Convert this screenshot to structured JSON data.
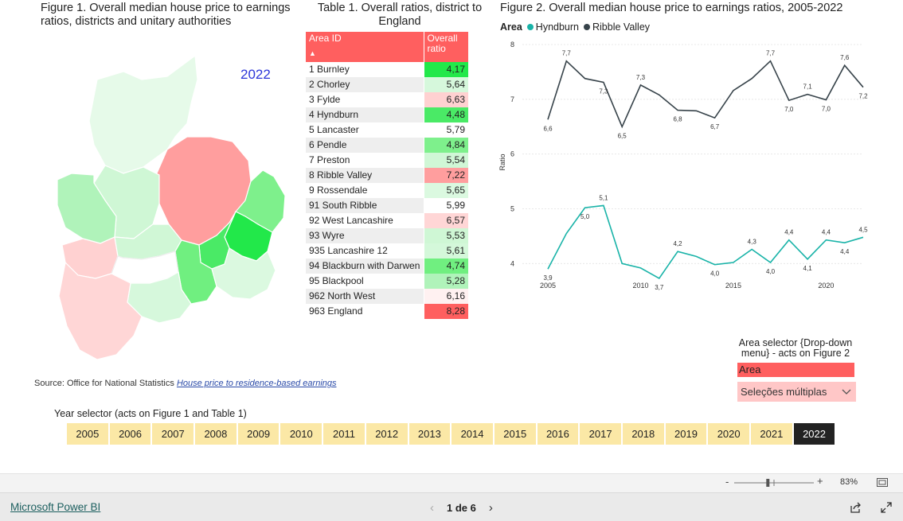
{
  "figure1": {
    "title": "Figure 1. Overall median house price to earnings ratios, districts and unitary authorities",
    "year": "2022"
  },
  "table1": {
    "title": "Table 1. Overall ratios, district to England",
    "col_area": "Area ID",
    "col_ratio": "Overall ratio",
    "rows": [
      {
        "area": "1 Burnley",
        "ratio": "4,17",
        "color": "#22e84a"
      },
      {
        "area": "2 Chorley",
        "ratio": "5,64",
        "color": "#d6f8dc"
      },
      {
        "area": "3 Fylde",
        "ratio": "6,63",
        "color": "#ffd1d1"
      },
      {
        "area": "4 Hyndburn",
        "ratio": "4,48",
        "color": "#4aea66"
      },
      {
        "area": "5 Lancaster",
        "ratio": "5,79",
        "color": "#ffffff"
      },
      {
        "area": "6 Pendle",
        "ratio": "4,84",
        "color": "#7ef08c"
      },
      {
        "area": "7 Preston",
        "ratio": "5,54",
        "color": "#d0f7d6"
      },
      {
        "area": "8 Ribble Valley",
        "ratio": "7,22",
        "color": "#ff9e9e"
      },
      {
        "area": "9 Rossendale",
        "ratio": "5,65",
        "color": "#dbf9e0"
      },
      {
        "area": "91 South Ribble",
        "ratio": "5,99",
        "color": "#ffffff"
      },
      {
        "area": "92 West Lancashire",
        "ratio": "6,57",
        "color": "#ffd6d6"
      },
      {
        "area": "93 Wyre",
        "ratio": "5,53",
        "color": "#cff7d5"
      },
      {
        "area": "935 Lancashire 12",
        "ratio": "5,61",
        "color": "#d4f8da"
      },
      {
        "area": "94 Blackburn with Darwen",
        "ratio": "4,74",
        "color": "#70ef80"
      },
      {
        "area": "95 Blackpool",
        "ratio": "5,28",
        "color": "#b0f3ba"
      },
      {
        "area": "962 North West",
        "ratio": "6,16",
        "color": "#fff1f1"
      },
      {
        "area": "963 England",
        "ratio": "8,28",
        "color": "#ff5f5f"
      }
    ]
  },
  "figure2": {
    "title": "Figure 2. Overall median house price to earnings ratios, 2005-2022"
  },
  "legend": {
    "label": "Area",
    "items": [
      {
        "name": "Hyndburn",
        "color": "#19b3a8"
      },
      {
        "name": "Ribble Valley",
        "color": "#37434a"
      }
    ]
  },
  "chart_data": {
    "type": "line",
    "ylabel": "Ratio",
    "ylim": [
      3.7,
      8.0
    ],
    "yticks": [
      4,
      5,
      6,
      7,
      8
    ],
    "xticks": [
      2005,
      2010,
      2015,
      2020
    ],
    "x": [
      2005,
      2006,
      2007,
      2008,
      2009,
      2010,
      2011,
      2012,
      2013,
      2014,
      2015,
      2016,
      2017,
      2018,
      2019,
      2020,
      2021,
      2022
    ],
    "series": [
      {
        "name": "Hyndburn",
        "color": "#19b3a8",
        "values": [
          3.9,
          4.55,
          5.02,
          5.06,
          4.0,
          3.92,
          3.73,
          4.22,
          4.13,
          3.98,
          4.02,
          4.26,
          4.02,
          4.43,
          4.08,
          4.43,
          4.38,
          4.48
        ],
        "labels": {
          "0": "3,9",
          "2": "5,0",
          "3": "5,1",
          "6": "3,7",
          "7": "4,2",
          "9": "4,0",
          "11": "4,3",
          "12": "4,0",
          "13": "4,4",
          "14": "4,1",
          "15": "4,4",
          "16": "4,4",
          "17": "4,5"
        }
      },
      {
        "name": "Ribble Valley",
        "color": "#37434a",
        "values": [
          6.63,
          7.7,
          7.38,
          7.31,
          6.5,
          7.26,
          7.08,
          6.8,
          6.79,
          6.66,
          7.16,
          7.38,
          7.7,
          6.98,
          7.09,
          6.99,
          7.62,
          7.22
        ],
        "labels": {
          "0": "6,6",
          "1": "7,7",
          "3": "7,3",
          "4": "6,5",
          "5": "7,3",
          "7": "6,8",
          "9": "6,7",
          "12": "7,7",
          "13": "7,0",
          "14": "7,1",
          "15": "7,0",
          "16": "7,6",
          "17": "7,2"
        }
      }
    ]
  },
  "source": {
    "prefix": "Source: Office for National Statistics",
    "link": "House price to residence-based earnings"
  },
  "year_selector": {
    "label": "Year selector (acts on Figure 1 and Table 1)",
    "years": [
      "2005",
      "2006",
      "2007",
      "2008",
      "2009",
      "2010",
      "2011",
      "2012",
      "2013",
      "2014",
      "2015",
      "2016",
      "2017",
      "2018",
      "2019",
      "2020",
      "2021",
      "2022"
    ],
    "selected": "2022"
  },
  "area_selector": {
    "label": "Area selector {Drop-down menu} - acts on Figure 2",
    "header": "Area",
    "dropdown_value": "Seleções múltiplas"
  },
  "zoom": {
    "percent": "83%",
    "level": 0.42
  },
  "footer": {
    "brand": "Microsoft Power BI",
    "page": "1 de 6"
  }
}
